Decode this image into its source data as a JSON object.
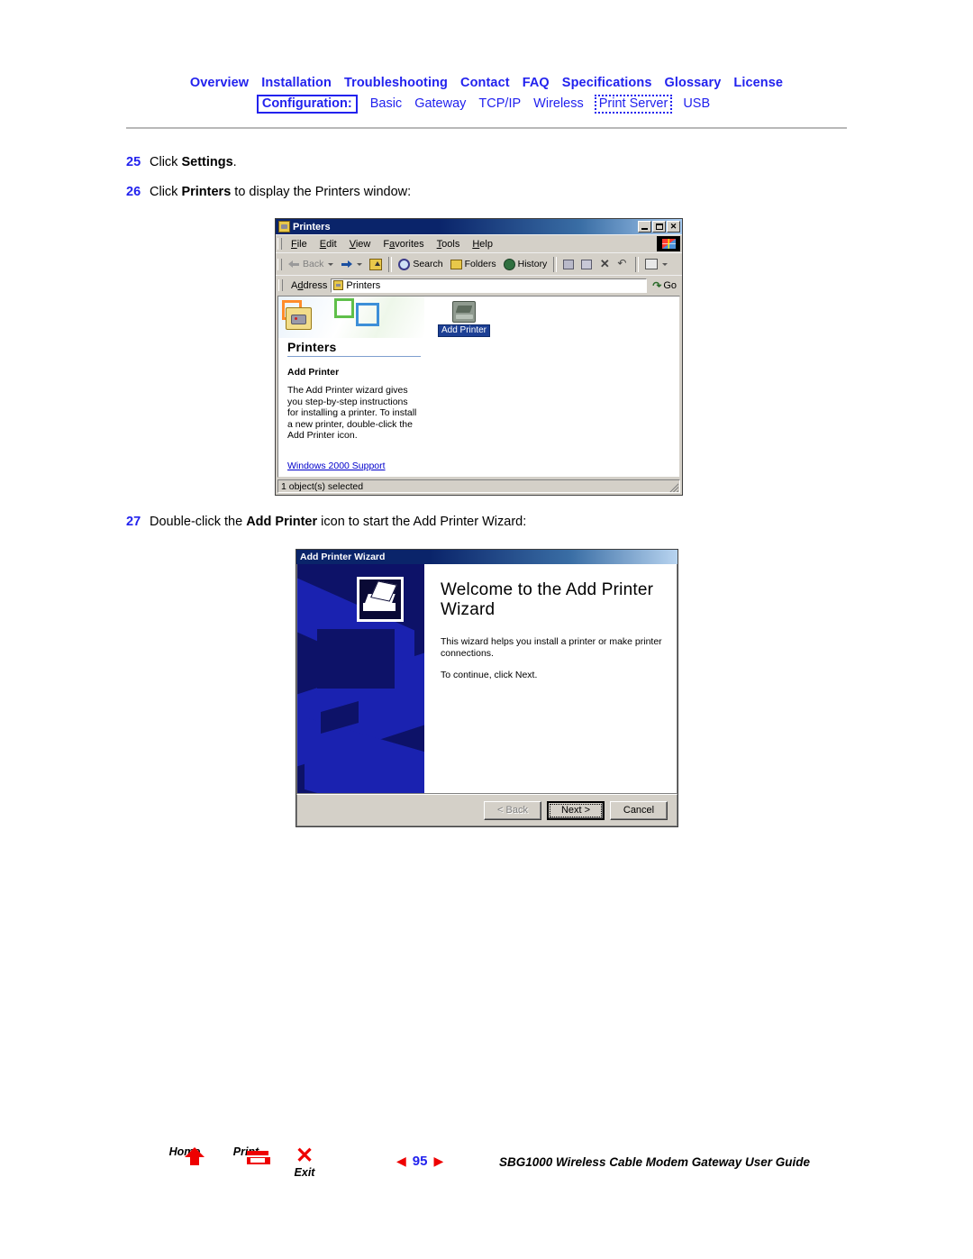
{
  "nav": {
    "primary": [
      {
        "label": "Overview"
      },
      {
        "label": "Installation"
      },
      {
        "label": "Troubleshooting"
      },
      {
        "label": "Contact"
      },
      {
        "label": "FAQ"
      },
      {
        "label": "Specifications"
      },
      {
        "label": "Glossary"
      },
      {
        "label": "License"
      }
    ],
    "config_label": "Configuration:",
    "secondary": [
      {
        "label": "Basic",
        "active": false
      },
      {
        "label": "Gateway",
        "active": false
      },
      {
        "label": "TCP/IP",
        "active": false
      },
      {
        "label": "Wireless",
        "active": false
      },
      {
        "label": "Print Server",
        "active": true
      },
      {
        "label": "USB",
        "active": false
      }
    ],
    "link_color": "#2222ee"
  },
  "steps": {
    "s25": {
      "num": "25",
      "pre": "Click ",
      "bold": "Settings",
      "post": "."
    },
    "s26": {
      "num": "26",
      "pre": "Click ",
      "bold": "Printers",
      "post": " to display the Printers window:"
    },
    "s27": {
      "num": "27",
      "pre": "Double-click the ",
      "bold": "Add Printer",
      "post": " icon to start the Add Printer Wizard:"
    }
  },
  "printers_window": {
    "title": "Printers",
    "window_buttons": {
      "minimize": "_",
      "maximize": "□",
      "close": "✕"
    },
    "menus": [
      {
        "label": "File",
        "accel": "F"
      },
      {
        "label": "Edit",
        "accel": "E"
      },
      {
        "label": "View",
        "accel": "V"
      },
      {
        "label": "Favorites",
        "accel": "a"
      },
      {
        "label": "Tools",
        "accel": "T"
      },
      {
        "label": "Help",
        "accel": "H"
      }
    ],
    "toolbar": [
      {
        "label": "Back",
        "icon": "back-arrow-icon",
        "disabled": true,
        "dropdown": true
      },
      {
        "label": "",
        "icon": "forward-arrow-icon",
        "disabled": false,
        "dropdown": true
      },
      {
        "label": "",
        "icon": "up-folder-icon",
        "disabled": false,
        "dropdown": false
      },
      {
        "label": "Search",
        "icon": "search-icon",
        "disabled": false,
        "dropdown": false
      },
      {
        "label": "Folders",
        "icon": "folders-icon",
        "disabled": false,
        "dropdown": false
      },
      {
        "label": "History",
        "icon": "history-icon",
        "disabled": false,
        "dropdown": false
      },
      {
        "label": "",
        "icon": "move-to-icon",
        "disabled": false,
        "dropdown": false
      },
      {
        "label": "",
        "icon": "copy-to-icon",
        "disabled": false,
        "dropdown": false
      },
      {
        "label": "",
        "icon": "delete-icon",
        "disabled": false,
        "dropdown": false
      },
      {
        "label": "",
        "icon": "undo-icon",
        "disabled": false,
        "dropdown": false
      },
      {
        "label": "",
        "icon": "views-icon",
        "disabled": false,
        "dropdown": true
      }
    ],
    "address": {
      "label": "Address",
      "value": "Printers",
      "go_label": "Go"
    },
    "panel": {
      "heading": "Printers",
      "subheading": "Add Printer",
      "description": "The Add Printer wizard gives you step-by-step instructions for installing a printer. To install a new printer, double-click the Add Printer icon.",
      "support_link": "Windows 2000 Support"
    },
    "items": [
      {
        "label": "Add Printer",
        "selected": true
      }
    ],
    "status": "1 object(s) selected"
  },
  "wizard": {
    "title": "Add Printer Wizard",
    "heading": "Welcome to the Add Printer Wizard",
    "paragraphs": [
      "This wizard helps you install a printer or make printer connections.",
      "To continue, click Next."
    ],
    "buttons": {
      "back": "< Back",
      "back_accel": "B",
      "next": "Next >",
      "next_accel": "N",
      "cancel": "Cancel"
    }
  },
  "footer": {
    "home_label": "Home",
    "print_label": "Print",
    "exit_label": "Exit",
    "prev_arrow": "◀",
    "next_arrow": "▶",
    "page_number": "95",
    "guide_title": "SBG1000 Wireless Cable Modem Gateway User Guide",
    "accent_red": "#ee0000",
    "accent_blue": "#2222ee"
  }
}
